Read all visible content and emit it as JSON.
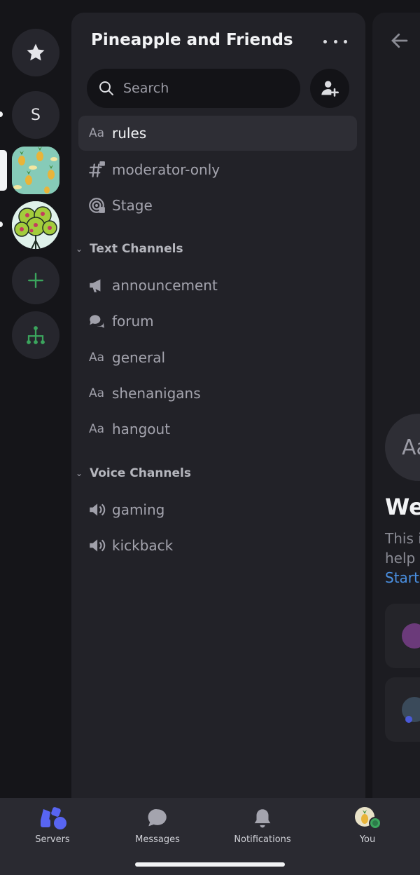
{
  "server_name": "Pineapple and Friends",
  "search": {
    "placeholder": "Search"
  },
  "rail": {
    "dm_initial": "S"
  },
  "channels_top": [
    {
      "label": "rules",
      "icon": "rules-icon",
      "active": true
    },
    {
      "label": "moderator-only",
      "icon": "locked-hash-icon"
    },
    {
      "label": "Stage",
      "icon": "stage-icon"
    }
  ],
  "categories": [
    {
      "label": "Text Channels",
      "channels": [
        {
          "label": "announcement",
          "icon": "megaphone-icon"
        },
        {
          "label": "forum",
          "icon": "forum-icon"
        },
        {
          "label": "general",
          "icon": "rules-icon"
        },
        {
          "label": "shenanigans",
          "icon": "rules-icon"
        },
        {
          "label": "hangout",
          "icon": "rules-icon"
        }
      ]
    },
    {
      "label": "Voice Channels",
      "channels": [
        {
          "label": "gaming",
          "icon": "voice-icon"
        },
        {
          "label": "kickback",
          "icon": "voice-icon"
        }
      ]
    }
  ],
  "peek": {
    "avatar_text": "Aa",
    "title": "We",
    "line1": "This i",
    "line2": "help y",
    "link": "Start"
  },
  "nav": [
    {
      "label": "Servers"
    },
    {
      "label": "Messages"
    },
    {
      "label": "Notifications"
    },
    {
      "label": "You"
    }
  ],
  "colors": {
    "accent": "#5865f2",
    "green": "#3ba55d",
    "link": "#4a90e2"
  }
}
